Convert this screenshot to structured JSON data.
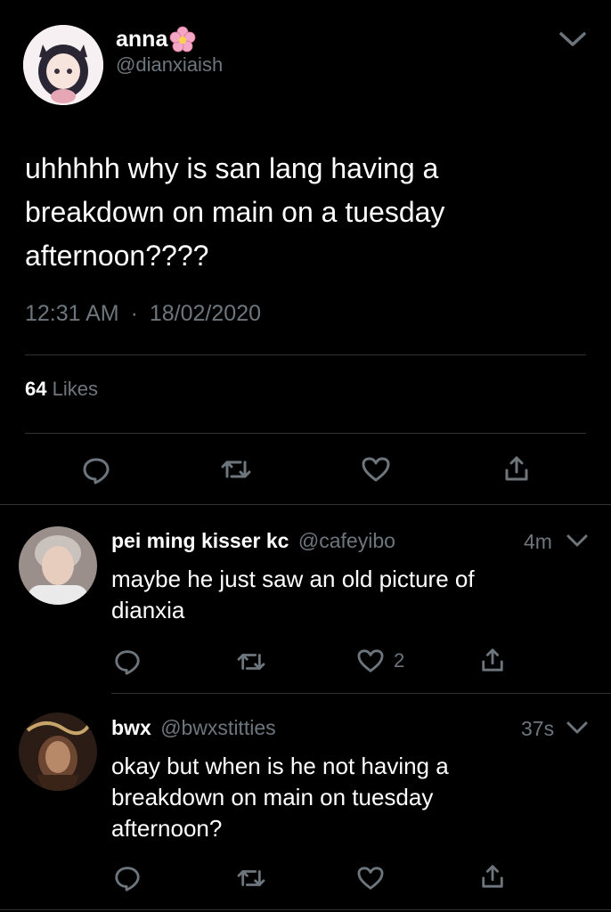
{
  "tweet": {
    "display_name": "anna",
    "handle": "@dianxiaish",
    "text_lines": [
      "uhhhhh why is san lang having a",
      "breakdown on main on a tuesday",
      "afternoon????"
    ],
    "time": "12:31 AM",
    "separator": "·",
    "date": "18/02/2020",
    "likes_count": "64",
    "likes_label": "Likes"
  },
  "replies": [
    {
      "display_name": "pei ming kisser kc",
      "handle": "@cafeyibo",
      "time": "4m",
      "text_lines": [
        "maybe he just saw an old picture of",
        "dianxia"
      ],
      "like_count": "2"
    },
    {
      "display_name": "bwx",
      "handle": "@bwxstitties",
      "time": "37s",
      "text_lines": [
        "okay but when is he not having a",
        "breakdown on main on tuesday",
        "afternoon?"
      ],
      "like_count": ""
    }
  ],
  "icons": {
    "reply": "reply-icon",
    "retweet": "retweet-icon",
    "like": "heart-icon",
    "share": "share-icon",
    "more": "chevron-down-icon",
    "emoji": "cherry-blossom-icon"
  },
  "colors": {
    "background": "#000000",
    "text": "#ffffff",
    "muted": "#6e767d",
    "divider": "#2f3336"
  }
}
